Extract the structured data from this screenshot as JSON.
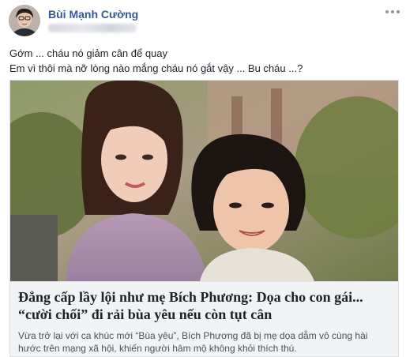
{
  "post": {
    "author": "Bùi Mạnh Cường",
    "status_lines": [
      "Gớm ... cháu nó giảm cân để quay",
      "Em vì thôi mà nỡ lòng nào mắng cháu nó gắt vậy ... Bu cháu ...?"
    ],
    "more_icon": "more-horizontal-icon"
  },
  "link_preview": {
    "title": "Đẳng cấp lầy lội như mẹ Bích Phương: Dọa cho con gái...\n“cười chối” đi rải bùa yêu nếu còn tụt cân",
    "description": "Vừa trở lại với ca khúc mới “Bùa yêu”, Bích Phương đã bị mẹ dọa dẫm vô cùng hài\nhước trên mạng xã hội, khiến người hâm mộ không khỏi thích thú."
  },
  "colors": {
    "author_name": "#365899",
    "card_background": "#f2f3f5",
    "card_border": "#dddfe2",
    "text_primary": "#1d2129",
    "text_secondary": "#4b4f56"
  }
}
